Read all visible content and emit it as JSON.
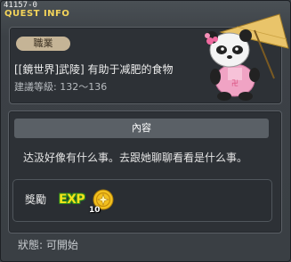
{
  "window": {
    "quest_id": "41157-0",
    "title": "QUEST INFO"
  },
  "quest": {
    "job_label": "職業",
    "name": "[[鏡世界]武陵] 有助于减肥的食物",
    "level_text": "建議等級: 132〜136"
  },
  "content": {
    "heading": "內容",
    "description": "达汲好像有什么事。去跟她聊聊看看是什么事。"
  },
  "reward": {
    "label": "獎勵",
    "exp_label": "EXP",
    "coin_count": "10"
  },
  "status": {
    "text": "狀態: 可開始"
  },
  "icons": {
    "mascot": "panda-with-umbrella-icon",
    "exp": "exp-icon",
    "coin": "gold-coin-icon"
  },
  "colors": {
    "title": "#f4d45a",
    "job_badge": "#c5b496",
    "content_header": "#5a6066",
    "background": "#3a3f44"
  }
}
